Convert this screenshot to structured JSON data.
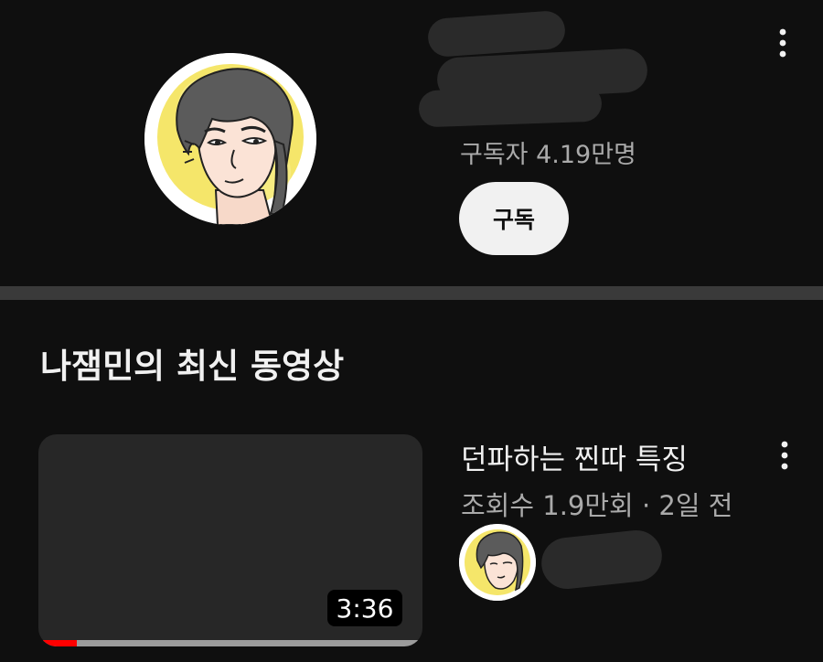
{
  "channel": {
    "subscriber_count": "구독자 4.19만명",
    "subscribe_label": "구독",
    "menu_icon": "more-vert-icon",
    "avatar_icon": "cartoon-face-avatar"
  },
  "section": {
    "title": "나잼민의 최신 동영상"
  },
  "video": {
    "title": "던파하는 찐따 특징",
    "meta": "조회수 1.9만회 · 2일 전",
    "duration": "3:36",
    "watched_fraction": 0.1,
    "menu_icon": "more-vert-icon"
  },
  "colors": {
    "background": "#0f0f0f",
    "progress": "#ff0000",
    "avatar_glow": "#f5e66a"
  }
}
